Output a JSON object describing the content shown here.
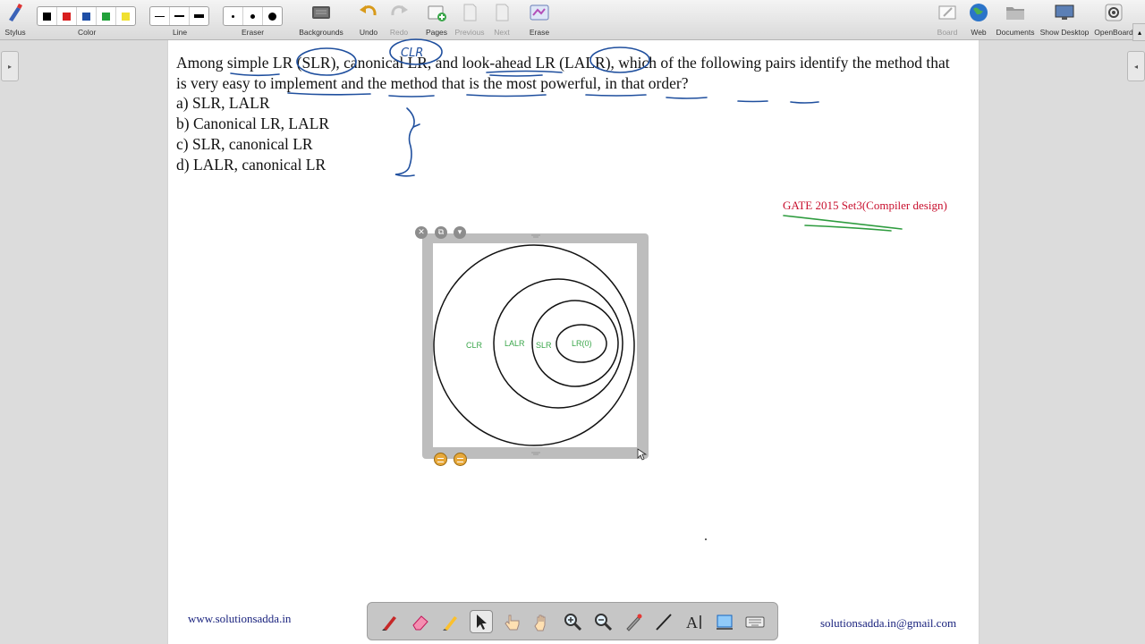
{
  "toolbar": {
    "stylus": "Stylus",
    "color": "Color",
    "line": "Line",
    "eraser": "Eraser",
    "backgrounds": "Backgrounds",
    "undo": "Undo",
    "redo": "Redo",
    "pages": "Pages",
    "previous": "Previous",
    "next": "Next",
    "erase": "Erase",
    "board": "Board",
    "web": "Web",
    "documents": "Documents",
    "show_desktop": "Show Desktop",
    "openboard": "OpenBoard",
    "colors": [
      "#000000",
      "#d81f1f",
      "#1f4fa6",
      "#22a13a",
      "#f0e030"
    ]
  },
  "question": {
    "stem": "Among simple LR (SLR), canonical LR, and look-ahead LR (LALR), which of the following pairs identify the method that is very easy to implement and the method that is the most powerful, in that order?",
    "options": [
      "a) SLR, LALR",
      "b) Canonical LR, LALR",
      "c) SLR, canonical LR",
      "d) LALR, canonical LR"
    ]
  },
  "annotation": {
    "clr_note": "CLR"
  },
  "reference": "GATE 2015 Set3(Compiler design)",
  "diagram": {
    "labels": {
      "clr": "CLR",
      "lalr": "LALR",
      "slr": "SLR",
      "lr0": "LR(0)"
    },
    "label_color": "#3aa64a"
  },
  "footer": {
    "website": "www.solutionsadda.in",
    "email": "solutionsadda.in@gmail.com"
  }
}
